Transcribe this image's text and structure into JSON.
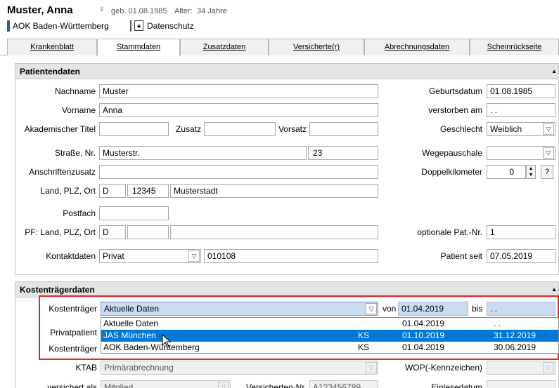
{
  "header": {
    "name": "Muster, Anna",
    "gender_icon": "female-symbol-icon",
    "birth": "geb. 01.08.1985",
    "age_label": "Alter:",
    "age": "34 Jahre",
    "kasse": "AOK Baden-Württemberg",
    "datenschutz": "Datenschutz"
  },
  "tabs": [
    {
      "label": "Krankenblatt"
    },
    {
      "label": "Stammdaten"
    },
    {
      "label": "Zusatzdaten"
    },
    {
      "label": "Versicherte(r)"
    },
    {
      "label": "Abrechnungsdaten"
    },
    {
      "label": "Scheinrückseite"
    }
  ],
  "patient": {
    "title": "Patientendaten",
    "nachname_label": "Nachname",
    "nachname": "Muster",
    "vorname_label": "Vorname",
    "vorname": "Anna",
    "titel_label": "Akademischer Titel",
    "titel": "",
    "zusatz_label": "Zusatz",
    "zusatz": "",
    "vorsatz_label": "Vorsatz",
    "vorsatz": "",
    "strasse_label": "Straße, Nr.",
    "strasse": "Musterstr.",
    "hausnr": "23",
    "anschrift_label": "Anschriftenzusatz",
    "anschrift": "",
    "land_label": "Land, PLZ, Ort",
    "land": "D",
    "plz": "12345",
    "ort": "Musterstadt",
    "postfach_label": "Postfach",
    "postfach": "",
    "pf_label": "PF: Land, PLZ, Ort",
    "pf_land": "D",
    "pf_plz": "",
    "pf_ort": "",
    "kontakt_label": "Kontaktdaten",
    "kontakt_typ": "Privat",
    "kontakt": "010108",
    "geburtsdatum_label": "Geburtsdatum",
    "geburtsdatum": "01.08.1985",
    "verstorben_label": "verstorben am",
    "verstorben": " . .",
    "geschlecht_label": "Geschlecht",
    "geschlecht": "Weiblich",
    "wege_label": "Wegepauschale",
    "wege": "",
    "doppel_label": "Doppelkilometer",
    "doppel": "0",
    "help": "?",
    "optpat_label": "optionale Pat.-Nr.",
    "optpat": "1",
    "seit_label": "Patient seit",
    "seit": "07.05.2019"
  },
  "kosten": {
    "title": "Kostenträgerdaten",
    "kt_label": "Kostenträger",
    "kt_selected": "Aktuelle Daten",
    "von_label": "von",
    "von": "01.04.2019",
    "bis_label": "bis",
    "bis": " . .",
    "privat_label": "Privatpatient",
    "kt2_label": "Kostenträger",
    "ktab_label": "KTAB",
    "ktab": "Primärabrechnung",
    "wop_label": "WOP(-Kennzeichen)",
    "versichert_label": "versichert als",
    "versichert": "Mitglied",
    "vnr_label": "Versicherten-Nr.",
    "vnr": "A123456789",
    "einlese_label": "Einlesedatum",
    "options": [
      {
        "name": "Aktuelle Daten",
        "code": "",
        "from": "01.04.2019",
        "to": " . ."
      },
      {
        "name": "JAS München",
        "code": "KS",
        "from": "01.10.2019",
        "to": "31.12.2019"
      },
      {
        "name": "AOK Baden-Württemberg",
        "code": "KS",
        "from": "01.04.2019",
        "to": "30.06.2019"
      }
    ]
  }
}
